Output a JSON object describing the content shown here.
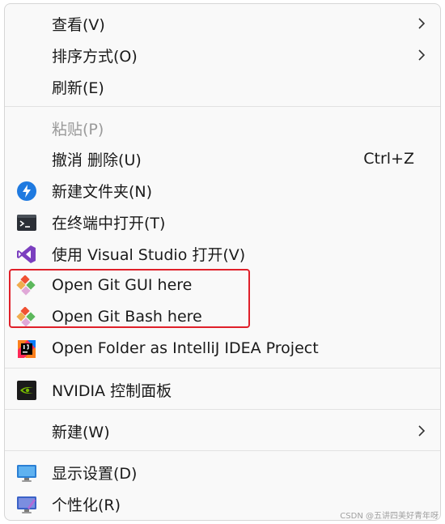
{
  "menu": {
    "items": [
      {
        "label": "查看(V)",
        "submenu": true
      },
      {
        "label": "排序方式(O)",
        "submenu": true
      },
      {
        "label": "刷新(E)"
      },
      {
        "label": "粘贴(P)",
        "disabled": true
      },
      {
        "label": "撤消 删除(U)",
        "shortcut": "Ctrl+Z"
      },
      {
        "label": "新建文件夹(N)",
        "icon": "new-folder-icon"
      },
      {
        "label": "在终端中打开(T)",
        "icon": "terminal-icon"
      },
      {
        "label": "使用 Visual Studio 打开(V)",
        "icon": "visual-studio-icon"
      },
      {
        "label": "Open Git GUI here",
        "icon": "git-icon"
      },
      {
        "label": "Open Git Bash here",
        "icon": "git-icon"
      },
      {
        "label": "Open Folder as IntelliJ IDEA Project",
        "icon": "intellij-icon"
      },
      {
        "label": "NVIDIA 控制面板",
        "icon": "nvidia-icon"
      },
      {
        "label": "新建(W)",
        "submenu": true
      },
      {
        "label": "显示设置(D)",
        "icon": "display-settings-icon"
      },
      {
        "label": "个性化(R)",
        "icon": "personalize-icon"
      }
    ]
  },
  "watermark": "CSDN @五讲四美好青年呀",
  "colors": {
    "highlight_border": "#e0202a",
    "git": "#f05133"
  }
}
